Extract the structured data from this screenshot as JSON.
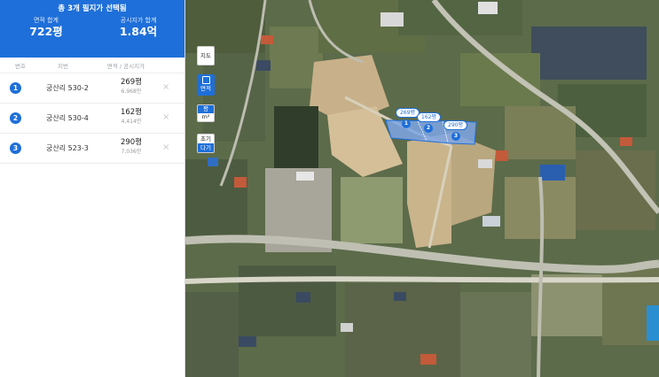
{
  "header": {
    "title": "총 3개 필지가 선택됨",
    "area_total_label": "면적 합계",
    "area_total_value": "722평",
    "price_total_label": "공시지가 합계",
    "price_total_value": "1.84억"
  },
  "table": {
    "col_number": "번호",
    "col_lot": "지번",
    "col_area_price": "면적 / 공시지가",
    "rows": [
      {
        "number": "1",
        "address": "궁산리 530-2",
        "area": "269평",
        "price": "6,968만"
      },
      {
        "number": "2",
        "address": "궁산리 530-4",
        "area": "162평",
        "price": "4,414만"
      },
      {
        "number": "3",
        "address": "궁산리 523-3",
        "area": "290평",
        "price": "7,036만"
      }
    ],
    "remove_glyph": "×"
  },
  "map_controls": {
    "map_button": "지도",
    "area_button": "면적",
    "unit_pyeong": "평",
    "unit_sqm": "m²",
    "reset_label": "초기",
    "clear_label": "다기"
  },
  "map": {
    "parcel_labels": [
      {
        "area": "269평",
        "number": "1"
      },
      {
        "area": "162평",
        "number": "2"
      },
      {
        "area": "290평",
        "number": "3"
      }
    ],
    "colors": {
      "accent": "#1e6fd9",
      "parcel_fill": "#7ea6e6"
    }
  }
}
